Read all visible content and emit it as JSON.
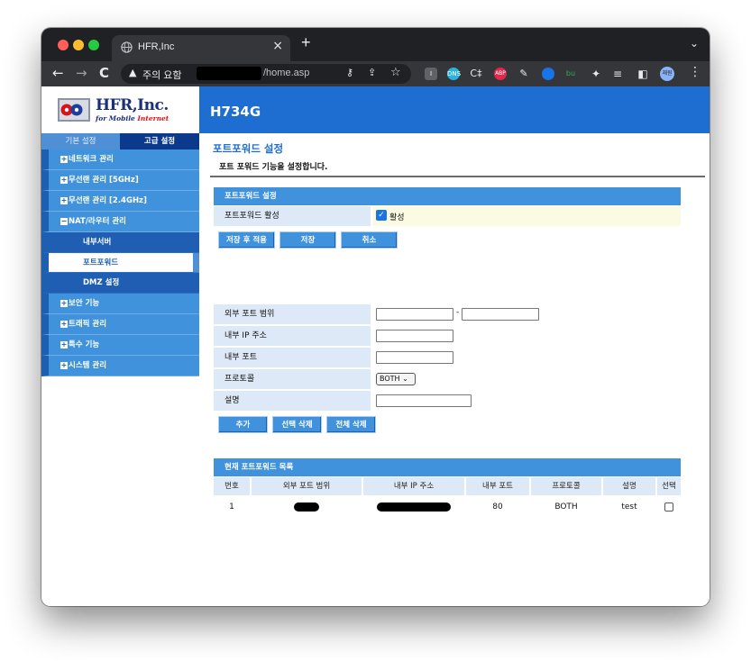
{
  "browser": {
    "tab_title": "HFR,Inc",
    "tab_close": "×",
    "new_tab": "+",
    "tab_menu": "⌄",
    "security_warning": "주의 요함",
    "url_suffix": "/home.asp",
    "profile_label": "재원",
    "extensions": [
      "I",
      "DNS",
      "C‡",
      "ABP",
      "✎",
      "⬤",
      "bu",
      "✦",
      "≡",
      "◧"
    ]
  },
  "logo": {
    "name": "HFR,Inc.",
    "tagline_prefix": "for Mobile ",
    "tagline_suffix": "Internet"
  },
  "banner": {
    "model": "H734G"
  },
  "sidebar": {
    "tabs": {
      "basic": "기본 설정",
      "advanced": "고급 설정"
    },
    "items": [
      {
        "label": "네트워크 관리",
        "icon": "+"
      },
      {
        "label": "무선랜 관리 [5GHz]",
        "icon": "+"
      },
      {
        "label": "무선랜 관리 [2.4GHz]",
        "icon": "+"
      },
      {
        "label": "NAT/라우터 관리",
        "icon": "−"
      },
      {
        "label": "보안 기능",
        "icon": "+"
      },
      {
        "label": "트래픽 관리",
        "icon": "+"
      },
      {
        "label": "특수 기능",
        "icon": "+"
      },
      {
        "label": "시스템 관리",
        "icon": "+"
      }
    ],
    "subitems": [
      "내부서버",
      "포트포워드",
      "DMZ 설정"
    ]
  },
  "content": {
    "title": "포트포워드 설정",
    "description": "포트 포워드 기능을 설정합니다.",
    "settings_header": "포트포워드 설정",
    "enable_label": "포트포워드 활성",
    "enable_value": "활성",
    "enable_checked": "✓",
    "buttons": {
      "apply": "저장 후 적용",
      "save": "저장",
      "cancel": "취소"
    },
    "form": {
      "ext_range": "외부 포트 범위",
      "range_dash": "-",
      "int_ip": "내부 IP 주소",
      "int_port": "내부 포트",
      "protocol": "프로토콜",
      "protocol_value": "BOTH",
      "protocol_arrow": "⌄",
      "desc": "설명"
    },
    "form_buttons": {
      "add": "추가",
      "delete_selected": "선택 삭제",
      "delete_all": "전체 삭제"
    },
    "list_header": "현재 포트포워드 목록",
    "table": {
      "columns": [
        "번호",
        "외부 포트 범위",
        "내부 IP 주소",
        "내부 포트",
        "프로토콜",
        "설명",
        "선택"
      ],
      "rows": [
        {
          "no": "1",
          "int_port": "80",
          "protocol": "BOTH",
          "desc": "test"
        }
      ]
    }
  }
}
